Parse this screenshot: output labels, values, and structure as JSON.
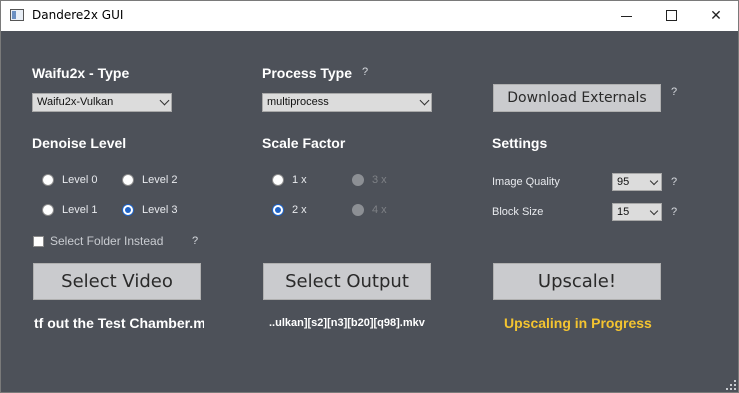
{
  "window": {
    "title": "Dandere2x GUI"
  },
  "waifu2x": {
    "heading": "Waifu2x - Type",
    "selected": "Waifu2x-Vulkan"
  },
  "process": {
    "heading": "Process Type",
    "help": "?",
    "selected": "multiprocess"
  },
  "download": {
    "label": "Download Externals",
    "help": "?"
  },
  "denoise": {
    "heading": "Denoise Level",
    "options": [
      "Level 0",
      "Level 2",
      "Level 1",
      "Level 3"
    ],
    "selected": "Level 3"
  },
  "scale": {
    "heading": "Scale Factor",
    "options": [
      "1 x",
      "3 x",
      "2 x",
      "4 x"
    ],
    "selected": "2 x",
    "disabled": [
      "3 x",
      "4 x"
    ]
  },
  "settings": {
    "heading": "Settings",
    "image_quality_label": "Image Quality",
    "image_quality_value": "95",
    "image_quality_help": "?",
    "block_size_label": "Block Size",
    "block_size_value": "15",
    "block_size_help": "?"
  },
  "folder": {
    "label": "Select Folder Instead",
    "help": "?",
    "checked": false
  },
  "buttons": {
    "select_video": "Select Video",
    "select_output": "Select Output",
    "upscale": "Upscale!"
  },
  "status": {
    "input_file": "tf out the Test Chamber.m",
    "output_file": "..ulkan][s2][n3][b20][q98].mkv",
    "message": "Upscaling in Progress"
  },
  "colors": {
    "background": "#4d5159",
    "status_accent": "#f4c430",
    "radio_accent": "#1f63c6"
  }
}
